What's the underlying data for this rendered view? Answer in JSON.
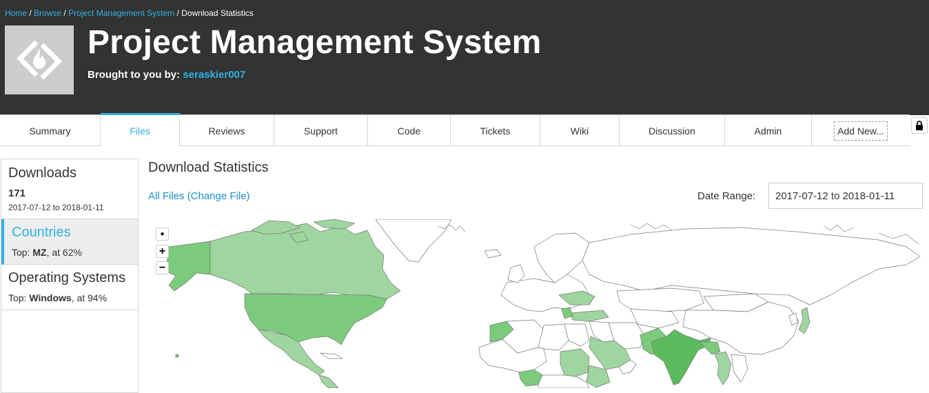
{
  "breadcrumb": {
    "items": [
      "Home",
      "Browse",
      "Project Management System"
    ],
    "separator": " / ",
    "current": "Download Statistics"
  },
  "project": {
    "title": "Project Management System",
    "brought_label": "Brought to you by: ",
    "author": "seraskier007",
    "logo_icon": "sourceforge-diamond-icon"
  },
  "tabs": [
    {
      "label": "Summary"
    },
    {
      "label": "Files",
      "active": true
    },
    {
      "label": "Reviews"
    },
    {
      "label": "Support"
    },
    {
      "label": "Code"
    },
    {
      "label": "Tickets"
    },
    {
      "label": "Wiki"
    },
    {
      "label": "Discussion"
    },
    {
      "label": "Admin"
    },
    {
      "label": "Add New..."
    }
  ],
  "sidebar": {
    "downloads": {
      "title": "Downloads",
      "count": "171",
      "range": "2017-07-12 to 2018-01-11"
    },
    "countries": {
      "title": "Countries",
      "top_label": "Top: ",
      "top_value": "MZ",
      "top_suffix": ", at 62%"
    },
    "os": {
      "title": "Operating Systems",
      "top_label": "Top: ",
      "top_value": "Windows",
      "top_suffix": ", at 94%"
    }
  },
  "main": {
    "title": "Download Statistics",
    "file_link": "All Files (Change File)",
    "date_label": "Date Range:",
    "date_value": "2017-07-12 to 2018-01-11"
  },
  "map": {
    "controls": {
      "reset": "●",
      "zoom_in": "+",
      "zoom_out": "−"
    },
    "colors": {
      "light": "#9fd59f",
      "mid": "#7ccb7c",
      "dark": "#5cbb5c",
      "border": "#666666",
      "none": "#ffffff"
    }
  },
  "colors": {
    "accent": "#30b0e6",
    "header_bg": "#333333",
    "logo_bg": "#cccccc"
  }
}
